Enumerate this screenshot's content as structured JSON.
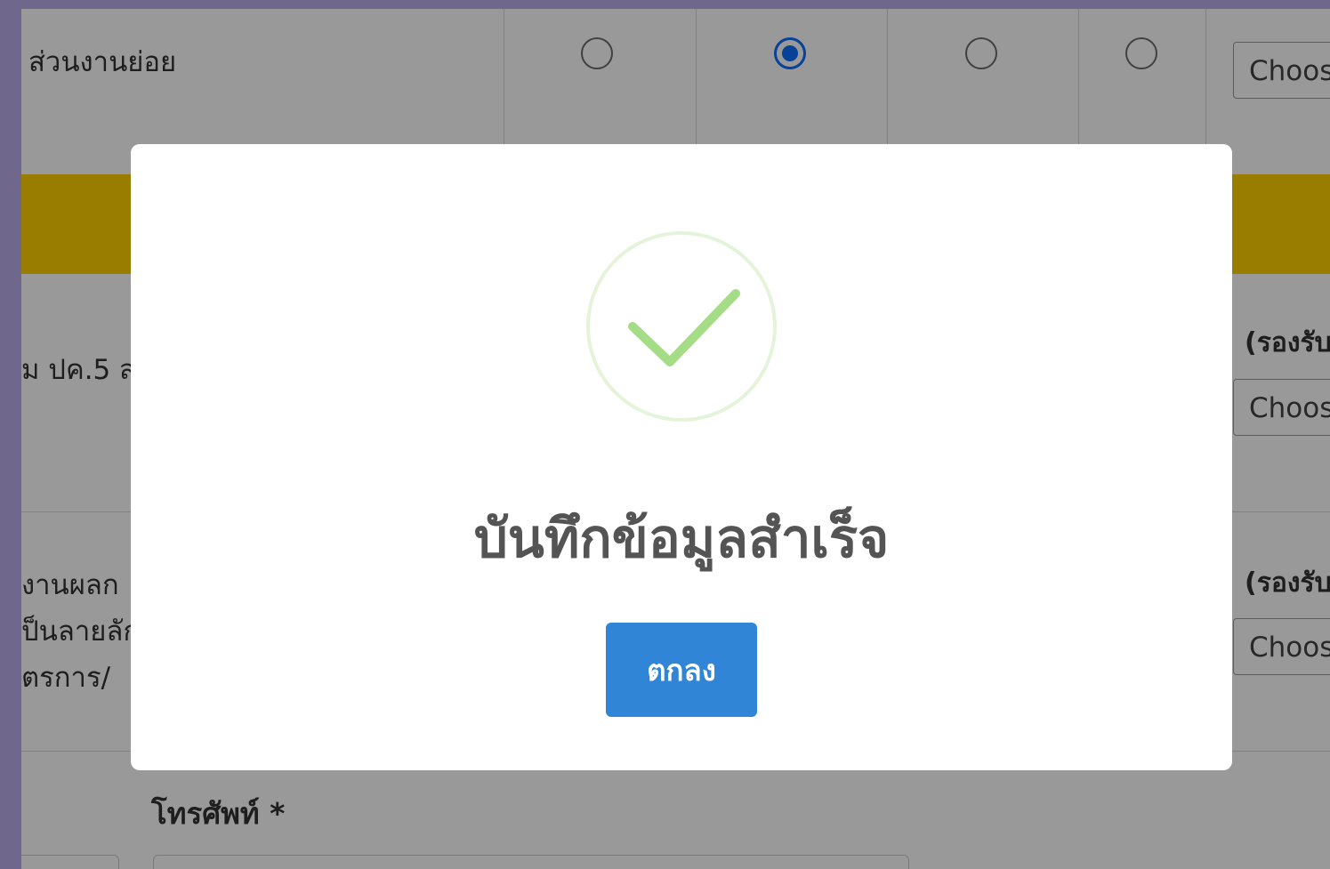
{
  "background_form": {
    "row1": {
      "label": "ส่วนงานย่อย",
      "radio_options_count": 4,
      "selected_option_index": 1,
      "choose_button": "Choos"
    },
    "row2": {
      "label_fragment": "ม ปค.5 ส่",
      "hint": "(รองรับ",
      "choose_button": "Choos"
    },
    "row3": {
      "label_lines": [
        "งานผลก",
        "ป็นลายลัก",
        "ตรการ/"
      ],
      "hint": "(รองรับ",
      "choose_button": "Choos"
    },
    "phone_label": "โทรศัพท์ *"
  },
  "dialog": {
    "icon": "success-check-icon",
    "title": "บันทึกข้อมูลสำเร็จ",
    "confirm_button": "ตกลง"
  },
  "colors": {
    "accent": "#3085d6",
    "success": "#a5dc86",
    "yellow_band": "#ffd100",
    "radio_checked": "#0d6efd",
    "backdrop_frame": "#b9aee9"
  }
}
